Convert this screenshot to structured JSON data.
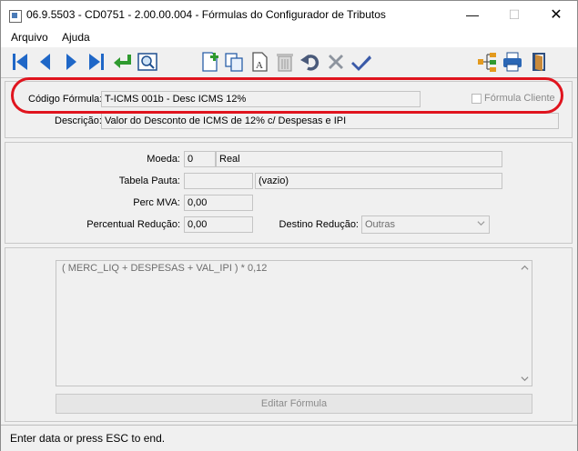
{
  "window": {
    "title": "06.9.5503 - CD0751 - 2.00.00.004 - Fórmulas do Configurador de Tributos",
    "controls": {
      "minimize": "—",
      "maximize": "☐",
      "close": "✕"
    }
  },
  "menu": {
    "items": [
      "Arquivo",
      "Ajuda"
    ]
  },
  "toolbar": {
    "buttons": [
      "first-record-icon",
      "previous-record-icon",
      "next-record-icon",
      "last-record-icon",
      "goto-icon",
      "search-icon",
      "new-icon",
      "copy-icon",
      "edit-icon",
      "delete-icon",
      "undo-icon",
      "cancel-icon",
      "save-icon",
      "tree-icon",
      "print-icon",
      "exit-icon"
    ],
    "colors": {
      "nav": "#1f67c7",
      "goto": "#2f9a2f",
      "disabled": "#9a9a9a",
      "check": "#3a5aa8"
    }
  },
  "header": {
    "codigo_label": "Código Fórmula:",
    "codigo_value": "T-ICMS 001b - Desc ICMS 12%",
    "formula_cliente_label": "Fórmula Cliente",
    "descricao_label": "Descrição:",
    "descricao_value": "Valor do Desconto de ICMS de 12% c/ Despesas e IPI",
    "highlight_color": "#e0141e"
  },
  "details": {
    "moeda_label": "Moeda:",
    "moeda_code": "0",
    "moeda_name": "Real",
    "tabela_label": "Tabela Pauta:",
    "tabela_code": "",
    "tabela_name": "(vazio)",
    "perc_mva_label": "Perc MVA:",
    "perc_mva_value": "0,00",
    "percentual_reducao_label": "Percentual Redução:",
    "percentual_reducao_value": "0,00",
    "destino_label": "Destino Redução:",
    "destino_value": "Outras"
  },
  "formula": {
    "expression": "( MERC_LIQ + DESPESAS + VAL_IPI ) * 0,12",
    "edit_button": "Editar Fórmula"
  },
  "status": {
    "message": "Enter data or press ESC to end."
  }
}
